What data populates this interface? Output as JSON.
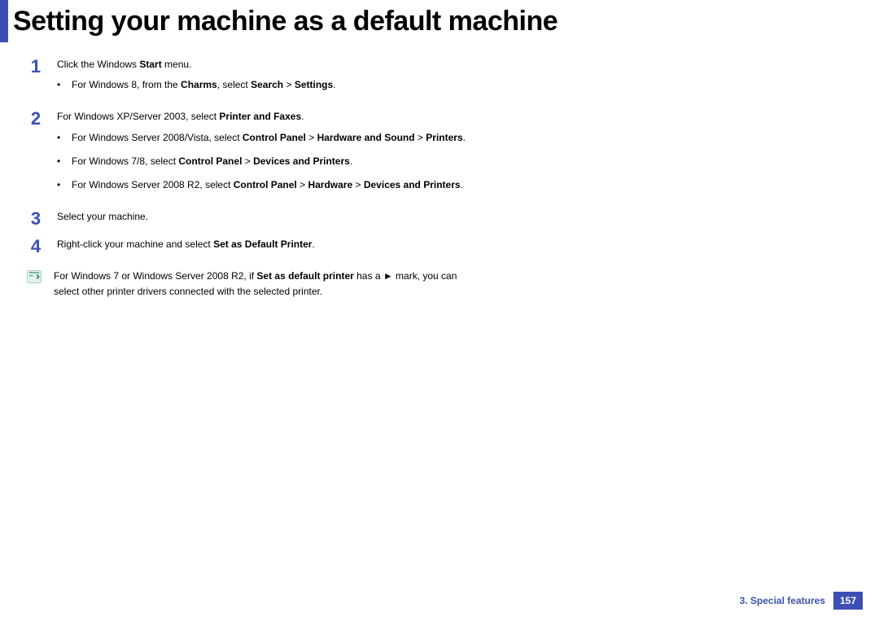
{
  "title": "Setting your machine as a default machine",
  "steps": [
    {
      "num": "1",
      "lines": [
        {
          "segments": [
            {
              "t": "Click the Windows ",
              "b": false
            },
            {
              "t": "Start",
              "b": true
            },
            {
              "t": " menu.",
              "b": false
            }
          ]
        }
      ],
      "subs": [
        {
          "segments": [
            {
              "t": "For Windows 8, from the ",
              "b": false
            },
            {
              "t": "Charms",
              "b": true
            },
            {
              "t": ", select ",
              "b": false
            },
            {
              "t": "Search",
              "b": true
            },
            {
              "t": " > ",
              "b": false
            },
            {
              "t": "Settings",
              "b": true
            },
            {
              "t": ".",
              "b": false
            }
          ]
        }
      ]
    },
    {
      "num": "2",
      "lines": [
        {
          "segments": [
            {
              "t": "For Windows XP/Server 2003, select ",
              "b": false
            },
            {
              "t": "Printer and Faxes",
              "b": true
            },
            {
              "t": ".",
              "b": false
            }
          ]
        }
      ],
      "subs": [
        {
          "segments": [
            {
              "t": "For Windows Server 2008/Vista, select ",
              "b": false
            },
            {
              "t": "Control Panel",
              "b": true
            },
            {
              "t": " > ",
              "b": false
            },
            {
              "t": "Hardware and Sound",
              "b": true
            },
            {
              "t": " > ",
              "b": false
            },
            {
              "t": "Printers",
              "b": true
            },
            {
              "t": ".",
              "b": false
            }
          ]
        },
        {
          "segments": [
            {
              "t": "For Windows 7/8, select ",
              "b": false
            },
            {
              "t": "Control Panel",
              "b": true
            },
            {
              "t": " > ",
              "b": false
            },
            {
              "t": "Devices and Printers",
              "b": true
            },
            {
              "t": ".",
              "b": false
            }
          ]
        },
        {
          "segments": [
            {
              "t": "For Windows Server 2008 R2, select ",
              "b": false
            },
            {
              "t": "Control Panel",
              "b": true
            },
            {
              "t": " > ",
              "b": false
            },
            {
              "t": "Hardware",
              "b": true
            },
            {
              "t": " > ",
              "b": false
            },
            {
              "t": "Devices and Printers",
              "b": true
            },
            {
              "t": ".",
              "b": false
            }
          ]
        }
      ]
    },
    {
      "num": "3",
      "lines": [
        {
          "segments": [
            {
              "t": "Select your machine.",
              "b": false
            }
          ]
        }
      ],
      "subs": []
    },
    {
      "num": "4",
      "lines": [
        {
          "segments": [
            {
              "t": "Right-click your machine and select ",
              "b": false
            },
            {
              "t": "Set as Default Printer",
              "b": true
            },
            {
              "t": ".",
              "b": false
            }
          ]
        }
      ],
      "subs": []
    }
  ],
  "note": {
    "segments": [
      {
        "t": "For Windows 7 or Windows Server 2008 R2, if ",
        "b": false
      },
      {
        "t": "Set as default printer",
        "b": true
      },
      {
        "t": " has a ► mark, you can select other printer drivers connected with the selected printer.",
        "b": false
      }
    ]
  },
  "footer": {
    "chapter": "3.  Special features",
    "page": "157"
  },
  "bullet_char": "•"
}
